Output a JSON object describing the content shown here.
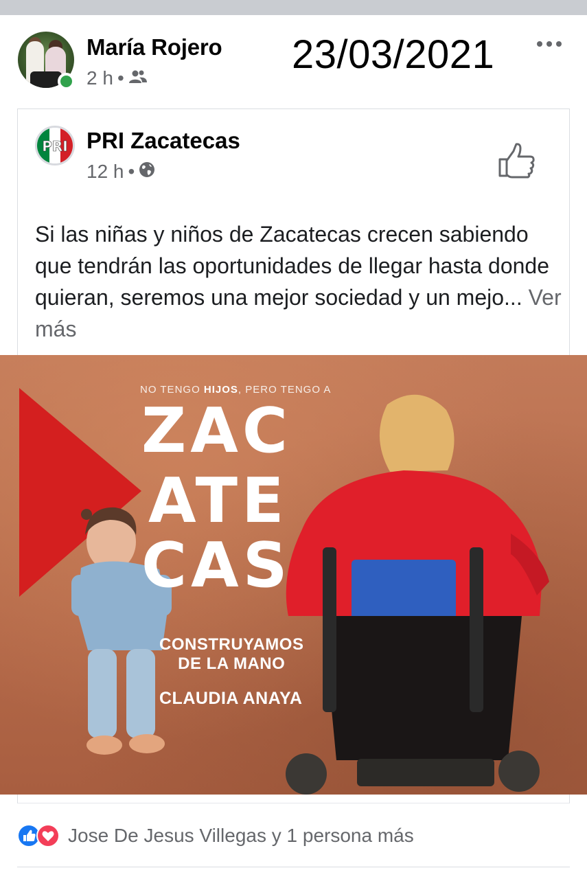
{
  "post": {
    "author": "María Rojero",
    "time": "2 h",
    "separator": "•",
    "audience_icon": "friends-icon",
    "overlay_date": "23/03/2021",
    "more_icon": "more-dots-icon"
  },
  "shared_post": {
    "page_name": "PRI Zacatecas",
    "time": "12 h",
    "separator": "•",
    "audience_icon": "globe-icon",
    "text": "Si las niñas y niños de Zacatecas crecen sabiendo que tendrán las oportunidades de llegar hasta donde quieran, seremos una mejor sociedad y un mejo...",
    "see_more": "Ver más"
  },
  "campaign_image": {
    "tagline_start": "NO TENGO ",
    "tagline_bold": "HIJOS",
    "tagline_end": ", PERO TENGO A",
    "line1": "ZAC",
    "line2": "ATE",
    "line3": "CAS",
    "slogan_1": "CONSTRUYAMOS",
    "slogan_2": "DE LA MANO",
    "candidate": "CLAUDIA ANAYA"
  },
  "reactions": {
    "summary": "Jose De Jesus Villegas y 1 persona más"
  },
  "colors": {
    "online": "#31a24c",
    "like_blue": "#1877f2",
    "love_red": "#f33e58",
    "secondary_text": "#65676b",
    "pri_red": "#d32027",
    "pri_green": "#00843d"
  }
}
